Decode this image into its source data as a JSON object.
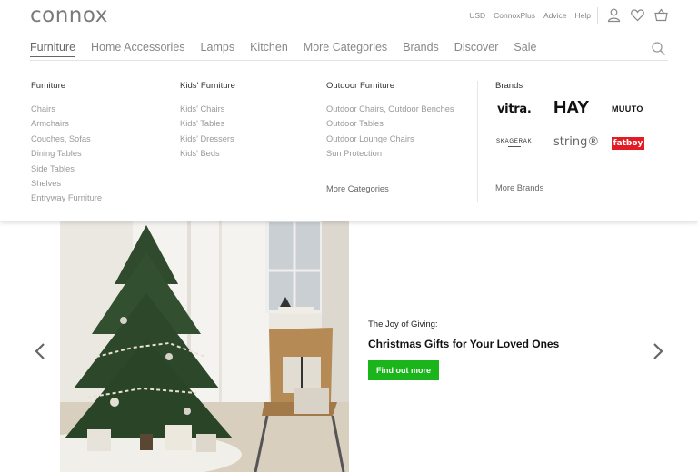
{
  "header": {
    "logo": "connox",
    "utility_links": [
      "USD",
      "ConnoxPlus",
      "Advice",
      "Help"
    ],
    "icons": [
      "user-icon",
      "heart-icon",
      "basket-icon"
    ]
  },
  "nav": {
    "items": [
      "Furniture",
      "Home Accessories",
      "Lamps",
      "Kitchen",
      "More Categories",
      "Brands",
      "Discover",
      "Sale"
    ],
    "active": "Furniture",
    "search_icon": "search-icon"
  },
  "mega_menu": {
    "columns": [
      {
        "heading": "Furniture",
        "items": [
          "Chairs",
          "Armchairs",
          "Couches, Sofas",
          "Dining Tables",
          "Side Tables",
          "Shelves",
          "Entryway Furniture"
        ]
      },
      {
        "heading": "Kids' Furniture",
        "items": [
          "Kids' Chairs",
          "Kids' Tables",
          "Kids' Dressers",
          "Kids' Beds"
        ]
      },
      {
        "heading": "Outdoor Furniture",
        "items": [
          "Outdoor Chairs, Outdoor Benches",
          "Outdoor Tables",
          "Outdoor Lounge Chairs",
          "Sun Protection"
        ],
        "more": "More Categories"
      }
    ],
    "brands": {
      "heading": "Brands",
      "logos": [
        "vitra.",
        "HAY",
        "MUUTO",
        "SKAGERAK",
        "string®",
        "fatboy"
      ],
      "more": "More Brands",
      "fatboy_color": "#e31b23"
    }
  },
  "hero": {
    "eyebrow": "The Joy of Giving:",
    "title": "Christmas Gifts for Your Loved Ones",
    "cta": "Find out more",
    "cta_color": "#1ab51a"
  }
}
